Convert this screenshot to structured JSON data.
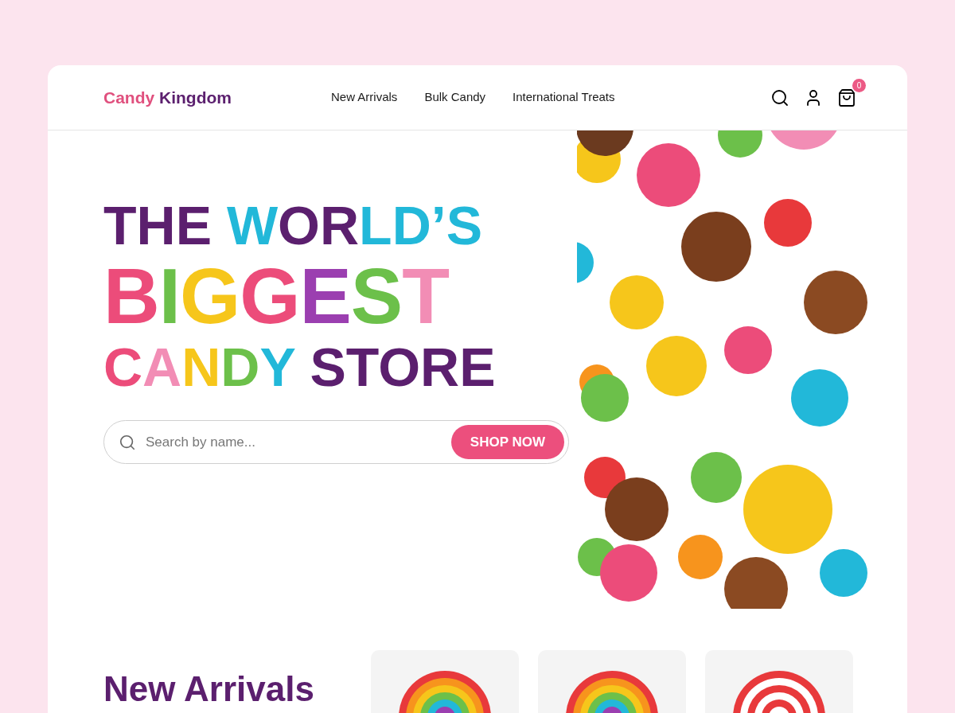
{
  "header": {
    "logo": [
      {
        "text": "Candy",
        "color": "#e0507e"
      },
      {
        "text": "Kingdom",
        "color": "#5b1f6e"
      }
    ],
    "nav": [
      {
        "label": "New Arrivals"
      },
      {
        "label": "Bulk Candy"
      },
      {
        "label": "International Treats"
      }
    ],
    "cart_badge": "0"
  },
  "hero": {
    "heading_lines": [
      [
        {
          "text": "THE ",
          "color": "#5b1f6e"
        },
        {
          "text": "W",
          "color": "#22b8d9"
        },
        {
          "text": "OR",
          "color": "#5b1f6e"
        },
        {
          "text": "LD’S",
          "color": "#22b8d9"
        }
      ],
      [
        {
          "text": "B",
          "color": "#ec4c7a"
        },
        {
          "text": "I",
          "color": "#6cc04a"
        },
        {
          "text": "G",
          "color": "#f6c61b"
        },
        {
          "text": "G",
          "color": "#ec4c7a"
        },
        {
          "text": "E",
          "color": "#9b3fb0"
        },
        {
          "text": "S",
          "color": "#6cc04a"
        },
        {
          "text": "T",
          "color": "#f28db5"
        }
      ],
      [
        {
          "text": "C",
          "color": "#ec4c7a"
        },
        {
          "text": "A",
          "color": "#f28db5"
        },
        {
          "text": "N",
          "color": "#f6c61b"
        },
        {
          "text": "D",
          "color": "#6cc04a"
        },
        {
          "text": "Y",
          "color": "#22b8d9"
        },
        {
          "text": " STORE",
          "color": "#5b1f6e"
        }
      ]
    ],
    "search": {
      "placeholder": "Search by name..."
    },
    "button": "SHOP NOW"
  },
  "new_arrivals": {
    "title": "New Arrivals",
    "products": [
      {
        "kind": "rainbow"
      },
      {
        "kind": "rainbow"
      },
      {
        "kind": "peppermint"
      }
    ]
  }
}
